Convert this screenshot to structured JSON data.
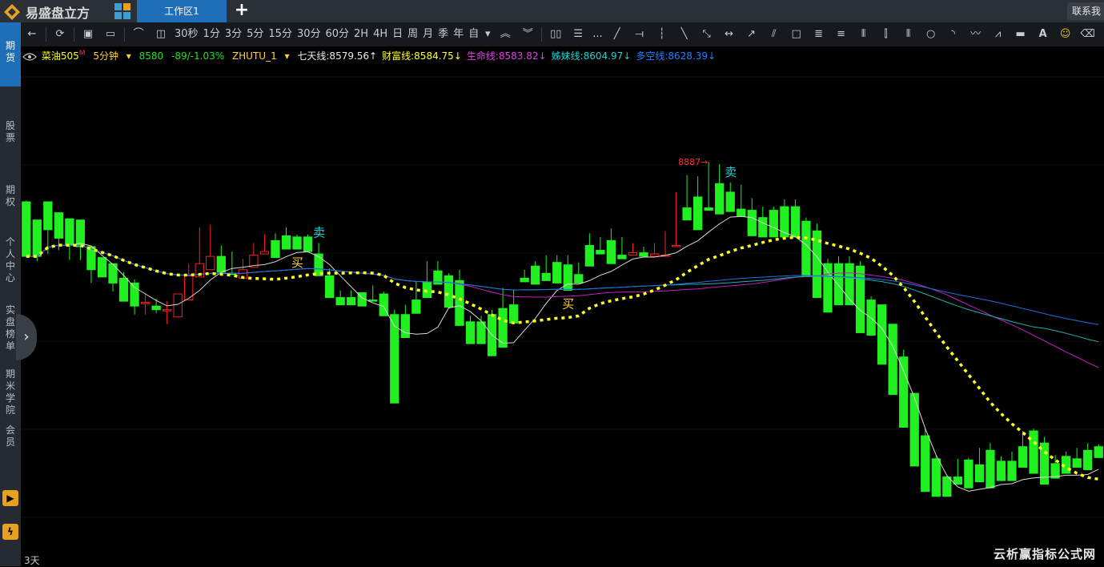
{
  "app": {
    "name": "易盛盘立方",
    "tab": "工作区1",
    "add_tab": "+",
    "contact": "联系我"
  },
  "sidebar": {
    "items": [
      {
        "label": "期\n货",
        "active": true
      },
      {
        "label": "股\n票",
        "active": false
      },
      {
        "label": "期\n权",
        "active": false
      },
      {
        "label": "个\n人\n中\n心",
        "active": false
      },
      {
        "label": "实\n盘\n榜\n单",
        "active": false
      },
      {
        "label": "期\n米\n学\n院",
        "active": false
      },
      {
        "label": "会\n员",
        "active": false
      }
    ],
    "expand_icon": "chevron-right-icon"
  },
  "toolbar": {
    "periods": [
      "30秒",
      "1分",
      "3分",
      "5分",
      "15分",
      "30分",
      "60分",
      "2H",
      "4H",
      "日",
      "周",
      "月",
      "季",
      "年",
      "自"
    ],
    "more": "..."
  },
  "info": {
    "symbol": "菜油505",
    "symbol_mark": "M",
    "period": "5分钟",
    "price": "8580",
    "change": "-89/-1.03%",
    "indicator": "ZHUTU_1",
    "lines": [
      {
        "label": "七天线:",
        "value": "8579.56",
        "arrow": "↑",
        "color": "#e8e8e8"
      },
      {
        "label": "财富线:",
        "value": "8584.75",
        "arrow": "↓",
        "color": "#ffff33"
      },
      {
        "label": "生命线:",
        "value": "8583.82",
        "arrow": "↓",
        "color": "#e040e0"
      },
      {
        "label": "姊妹线:",
        "value": "8604.97",
        "arrow": "↓",
        "color": "#20d0d0"
      },
      {
        "label": "多空线:",
        "value": "8628.39",
        "arrow": "↓",
        "color": "#2080ff"
      }
    ]
  },
  "chart_data": {
    "type": "candlestick",
    "max_label": "8887",
    "signals": [
      {
        "text": "卖",
        "candle": 27
      },
      {
        "text": "买",
        "candle": 25
      },
      {
        "text": "买",
        "candle": 50
      },
      {
        "text": "卖",
        "candle": 65
      }
    ],
    "candles": [
      [
        8779,
        8780,
        8734,
        8734
      ],
      [
        8764,
        8761,
        8730,
        8734
      ],
      [
        8779,
        8767,
        8736,
        8756
      ],
      [
        8770,
        8752,
        8739,
        8749
      ],
      [
        8765,
        8744,
        8731,
        8743
      ],
      [
        8764,
        8743,
        8731,
        8742
      ],
      [
        8742,
        8735,
        8712,
        8723
      ],
      [
        8733,
        8723,
        8717,
        8717
      ],
      [
        8728,
        8719,
        8705,
        8712
      ],
      [
        8716,
        8721,
        8697,
        8697
      ],
      [
        8712,
        8715,
        8686,
        8693
      ],
      [
        8696,
        8703,
        8686,
        8696
      ],
      [
        8693,
        8699,
        8687,
        8690
      ],
      [
        8690,
        8697,
        8678,
        8690
      ],
      [
        8684,
        8695,
        8686,
        8703
      ],
      [
        8698,
        8728,
        8715,
        8718
      ],
      [
        8717,
        8758,
        8735,
        8728
      ],
      [
        8723,
        8760,
        8747,
        8734
      ],
      [
        8734,
        8743,
        8739,
        8721
      ],
      [
        8720,
        8738,
        8719,
        8719
      ],
      [
        8716,
        8732,
        8719,
        8723
      ],
      [
        8725,
        8745,
        8726,
        8735
      ],
      [
        8736,
        8752,
        8744,
        8738
      ],
      [
        8747,
        8753,
        8744,
        8733
      ],
      [
        8751,
        8758,
        8757,
        8740
      ],
      [
        8750,
        8752,
        8747,
        8740
      ],
      [
        8750,
        8752,
        8746,
        8738
      ],
      [
        8736,
        8745,
        8736,
        8718
      ],
      [
        8718,
        8724,
        8716,
        8700
      ],
      [
        8700,
        8706,
        8700,
        8694
      ],
      [
        8700,
        8706,
        8700,
        8694
      ],
      [
        8704,
        8704,
        8699,
        8693
      ],
      [
        8698,
        8710,
        8704,
        8697
      ],
      [
        8703,
        8705,
        8703,
        8685
      ],
      [
        8686,
        8690,
        8684,
        8613
      ],
      [
        8686,
        8694,
        8685,
        8667
      ],
      [
        8698,
        8713,
        8710,
        8687
      ],
      [
        8713,
        8730,
        8726,
        8700
      ],
      [
        8722,
        8730,
        8720,
        8711
      ],
      [
        8718,
        8720,
        8716,
        8692
      ],
      [
        8714,
        8723,
        8714,
        8677
      ],
      [
        8680,
        8685,
        8681,
        8662
      ],
      [
        8680,
        8685,
        8681,
        8662
      ],
      [
        8686,
        8690,
        8684,
        8652
      ],
      [
        8691,
        8708,
        8697,
        8659
      ],
      [
        8694,
        8706,
        8701,
        8679
      ],
      [
        8716,
        8723,
        8723,
        8713
      ],
      [
        8726,
        8730,
        8725,
        8711
      ],
      [
        8720,
        8735,
        8723,
        8714
      ],
      [
        8729,
        8735,
        8725,
        8712
      ],
      [
        8727,
        8735,
        8721,
        8706
      ],
      [
        8719,
        8729,
        8719,
        8712
      ],
      [
        8743,
        8753,
        8743,
        8726
      ],
      [
        8739,
        8750,
        8746,
        8736
      ],
      [
        8747,
        8757,
        8747,
        8728
      ],
      [
        8735,
        8750,
        8740,
        8732
      ],
      [
        8735,
        8745,
        8741,
        8737
      ],
      [
        8737,
        8742,
        8738,
        8734
      ],
      [
        8734,
        8745,
        8736,
        8736
      ],
      [
        8734,
        8755,
        8741,
        8735
      ],
      [
        8743,
        8787,
        8756,
        8743
      ],
      [
        8774,
        8801,
        8774,
        8764
      ],
      [
        8783,
        8800,
        8787,
        8756
      ],
      [
        8774,
        8812,
        8786,
        8772
      ],
      [
        8794,
        8810,
        8787,
        8769
      ],
      [
        8787,
        8795,
        8771,
        8771
      ],
      [
        8773,
        8793,
        8771,
        8767
      ],
      [
        8772,
        8782,
        8770,
        8751
      ],
      [
        8766,
        8775,
        8766,
        8750
      ],
      [
        8772,
        8775,
        8762,
        8750
      ],
      [
        8775,
        8781,
        8772,
        8750
      ],
      [
        8775,
        8781,
        8772,
        8750
      ],
      [
        8763,
        8766,
        8755,
        8718
      ],
      [
        8755,
        8761,
        8727,
        8700
      ],
      [
        8728,
        8732,
        8710,
        8688
      ],
      [
        8728,
        8734,
        8728,
        8694
      ],
      [
        8728,
        8734,
        8728,
        8694
      ],
      [
        8726,
        8730,
        8698,
        8671
      ],
      [
        8698,
        8701,
        8694,
        8669
      ],
      [
        8694,
        8694,
        8678,
        8645
      ],
      [
        8678,
        8678,
        8660,
        8620
      ],
      [
        8651,
        8657,
        8638,
        8593
      ],
      [
        8621,
        8614,
        8587,
        8561
      ],
      [
        8586,
        8592,
        8567,
        8540
      ],
      [
        8567,
        8570,
        8552,
        8536
      ],
      [
        8552,
        8553,
        8543,
        8536
      ],
      [
        8552,
        8567,
        8553,
        8546
      ],
      [
        8566,
        8568,
        8563,
        8543
      ],
      [
        8562,
        8576,
        8574,
        8548
      ],
      [
        8574,
        8580,
        8568,
        8543
      ],
      [
        8565,
        8569,
        8566,
        8549
      ],
      [
        8565,
        8573,
        8565,
        8549
      ],
      [
        8577,
        8590,
        8590,
        8560
      ],
      [
        8590,
        8592,
        8585,
        8555
      ],
      [
        8580,
        8585,
        8565,
        8546
      ],
      [
        8563,
        8570,
        8569,
        8551
      ],
      [
        8569,
        8573,
        8567,
        8555
      ],
      [
        8567,
        8576,
        8576,
        8560
      ],
      [
        8574,
        8580,
        8572,
        8558
      ],
      [
        8577,
        8579,
        8580,
        8568
      ]
    ]
  },
  "footer": {
    "days": "3天",
    "watermark": "云析赢指标公式网"
  }
}
